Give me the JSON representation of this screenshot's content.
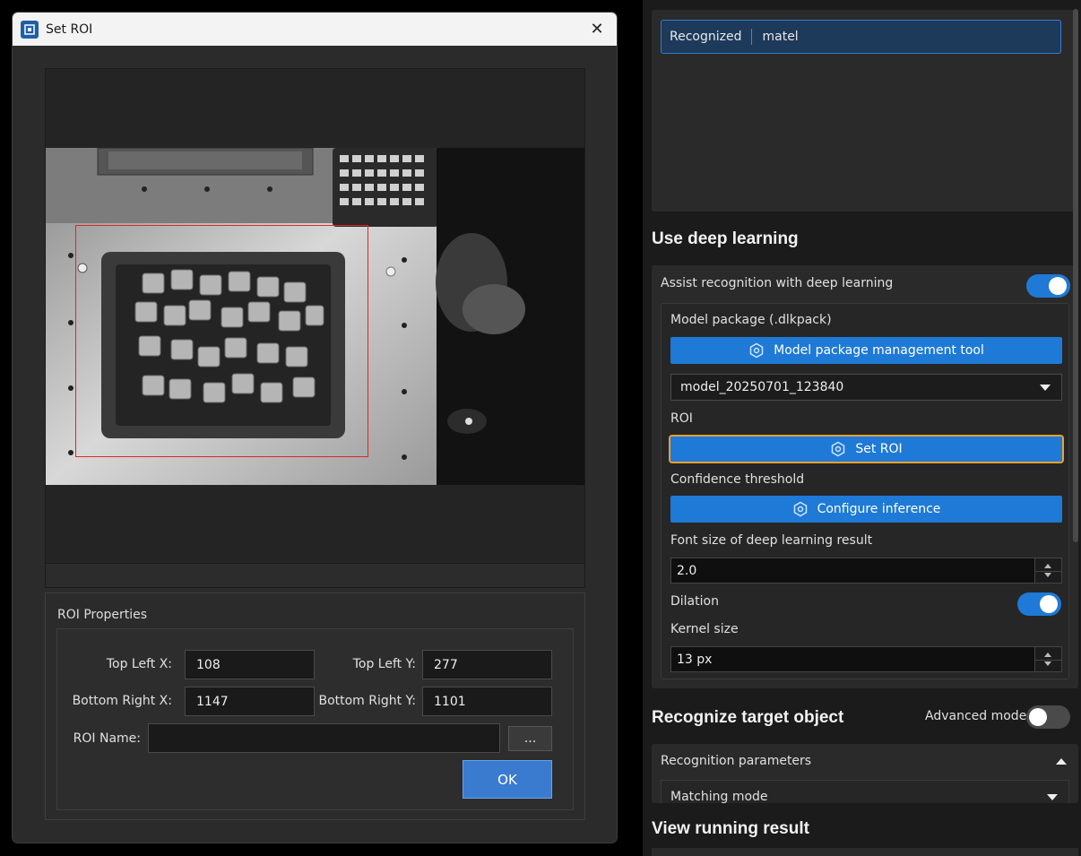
{
  "dialog": {
    "title": "Set ROI",
    "close_glyph": "✕",
    "properties": {
      "title": "ROI Properties",
      "top_left_x_label": "Top Left X:",
      "top_left_x": "108",
      "top_left_y_label": "Top Left Y:",
      "top_left_y": "277",
      "bottom_right_x_label": "Bottom Right X:",
      "bottom_right_x": "1147",
      "bottom_right_y_label": "Bottom Right Y:",
      "bottom_right_y": "1101",
      "roi_name_label": "ROI Name:",
      "roi_name": "",
      "browse_label": "...",
      "ok_label": "OK"
    },
    "roi_color": "#e0242a"
  },
  "panel": {
    "recognized_label": "Recognized",
    "recognized_value": "matel",
    "dl_section_title": "Use deep learning",
    "assist_label": "Assist recognition with deep learning",
    "assist_on": true,
    "model_package_label": "Model package (.dlkpack)",
    "model_tool_button": "Model package management tool",
    "model_selected": "model_20250701_123840",
    "roi_label": "ROI",
    "set_roi_button": "Set ROI",
    "confidence_label": "Confidence threshold",
    "configure_inference_button": "Configure inference",
    "font_size_label": "Font size of deep learning result",
    "font_size_value": "2.0",
    "dilation_label": "Dilation",
    "dilation_on": true,
    "kernel_size_label": "Kernel size",
    "kernel_size_value": "13 px",
    "recognize_section_title": "Recognize target object",
    "advanced_mode_label": "Advanced mode",
    "advanced_mode_on": false,
    "recognition_params_label": "Recognition parameters",
    "matching_mode_label": "Matching mode",
    "view_result_title": "View running result",
    "accent_color": "#1e7ad6",
    "focus_color": "#f0a030"
  }
}
